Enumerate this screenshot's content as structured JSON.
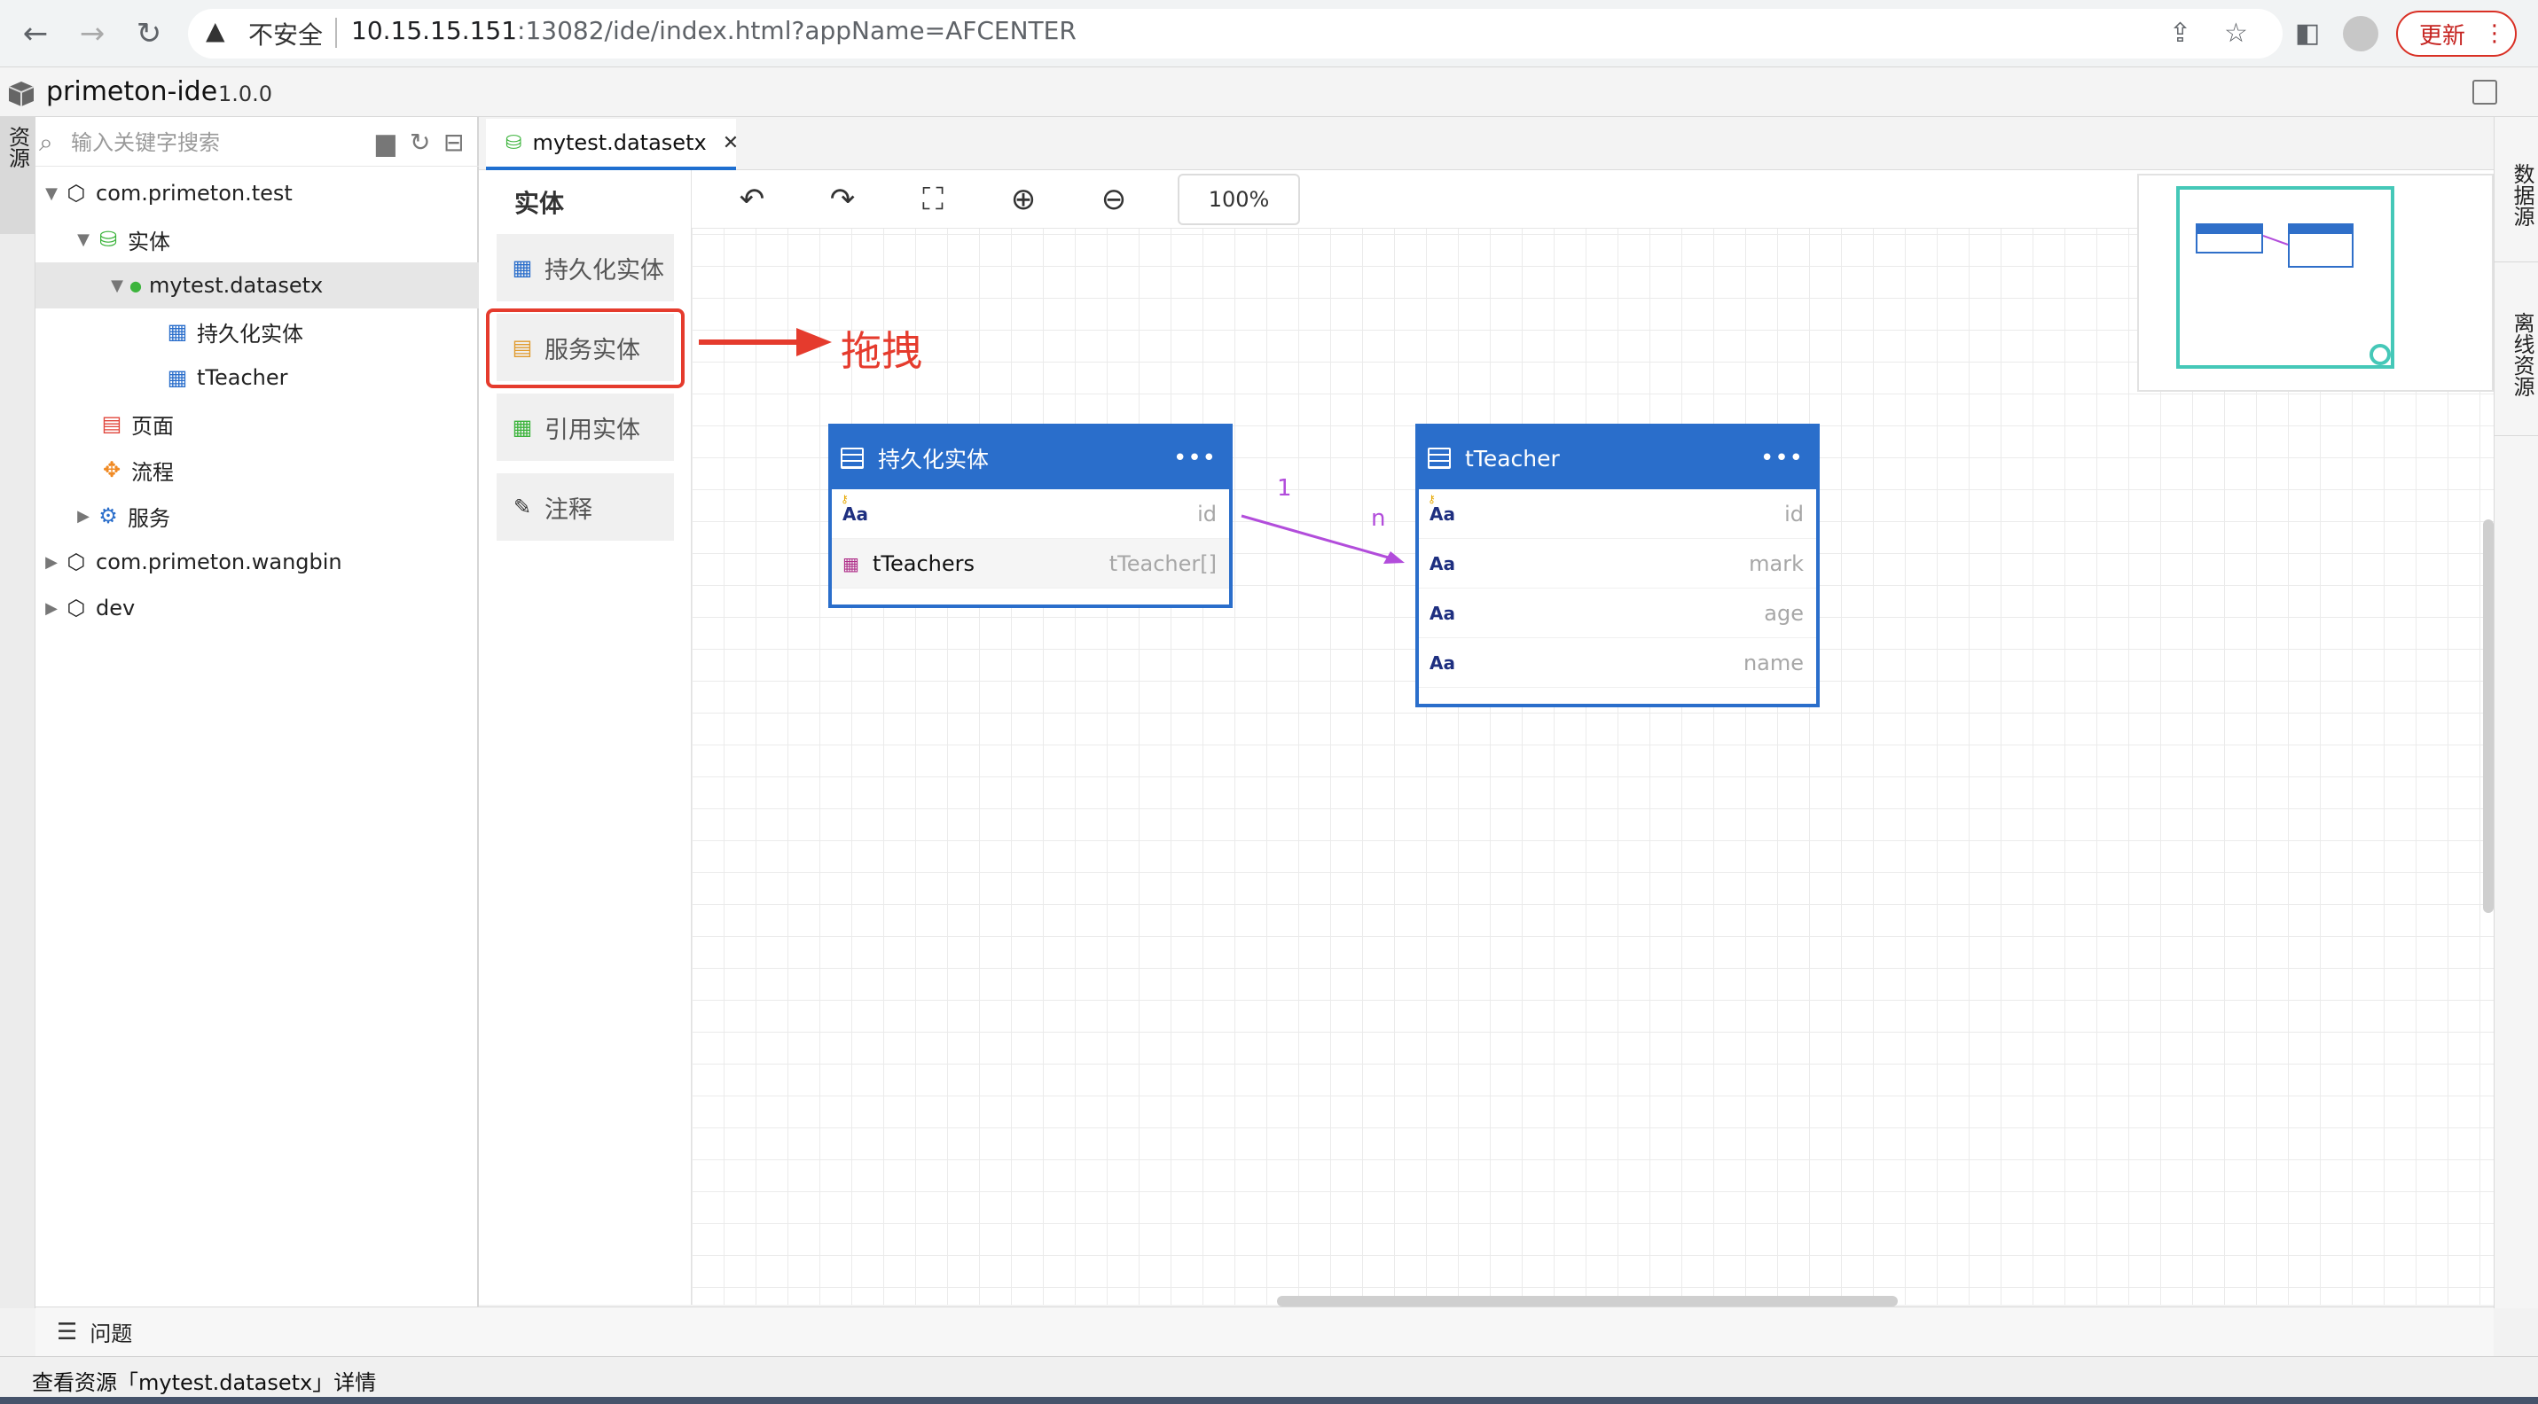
{
  "browser": {
    "security_label": "不安全",
    "url_host": "10.15.15.151",
    "url_path": ":13082/ide/index.html?appName=AFCENTER",
    "update_label": "更新"
  },
  "app": {
    "name": "primeton-ide",
    "version": "1.0.0"
  },
  "left_rail": {
    "resource_tab": "资源"
  },
  "right_rail": {
    "datasource_tab": "数据源",
    "offline_tab": "离线资源"
  },
  "tree": {
    "search_placeholder": "输入关键字搜索",
    "nodes": [
      {
        "label": "com.primeton.test",
        "icon": "package-icon",
        "expanded": true
      },
      {
        "label": "实体",
        "icon": "database-icon",
        "expanded": true
      },
      {
        "label": "mytest.datasetx",
        "icon": "dot-icon",
        "expanded": true,
        "selected": true
      },
      {
        "label": "持久化实体",
        "icon": "entity-table-icon"
      },
      {
        "label": "tTeacher",
        "icon": "entity-table-icon"
      },
      {
        "label": "页面",
        "icon": "page-icon"
      },
      {
        "label": "流程",
        "icon": "flow-icon"
      },
      {
        "label": "服务",
        "icon": "gear-icon",
        "expanded": false
      },
      {
        "label": "com.primeton.wangbin",
        "icon": "package-icon",
        "expanded": false
      },
      {
        "label": "dev",
        "icon": "package-icon",
        "expanded": false
      }
    ]
  },
  "editor": {
    "tab_label": "mytest.datasetx",
    "zoom": "100%"
  },
  "palette": {
    "title": "实体",
    "items": [
      {
        "label": "持久化实体",
        "icon": "persistent-entity-icon"
      },
      {
        "label": "服务实体",
        "icon": "service-entity-icon"
      },
      {
        "label": "引用实体",
        "icon": "reference-entity-icon"
      },
      {
        "label": "注释",
        "icon": "note-icon"
      }
    ],
    "annotation": "拖拽"
  },
  "entities": [
    {
      "name": "持久化实体",
      "fields": [
        {
          "name": "",
          "type": "id",
          "icon": "text-key-icon"
        },
        {
          "name": "tTeachers",
          "type": "tTeacher[]",
          "icon": "relation-table-icon"
        }
      ]
    },
    {
      "name": "tTeacher",
      "fields": [
        {
          "name": "",
          "type": "id",
          "icon": "text-key-icon"
        },
        {
          "name": "",
          "type": "mark",
          "icon": "text-icon"
        },
        {
          "name": "",
          "type": "age",
          "icon": "text-icon"
        },
        {
          "name": "",
          "type": "name",
          "icon": "text-icon"
        }
      ]
    }
  ],
  "relation": {
    "source_cardinality": "1",
    "target_cardinality": "n",
    "color": "#b24ddb"
  },
  "problems_label": "问题",
  "status_text": "查看资源「mytest.datasetx」详情",
  "colors": {
    "accent": "#2a6ecb",
    "highlight": "#e53b2d",
    "minimap": "#45c8b8"
  }
}
